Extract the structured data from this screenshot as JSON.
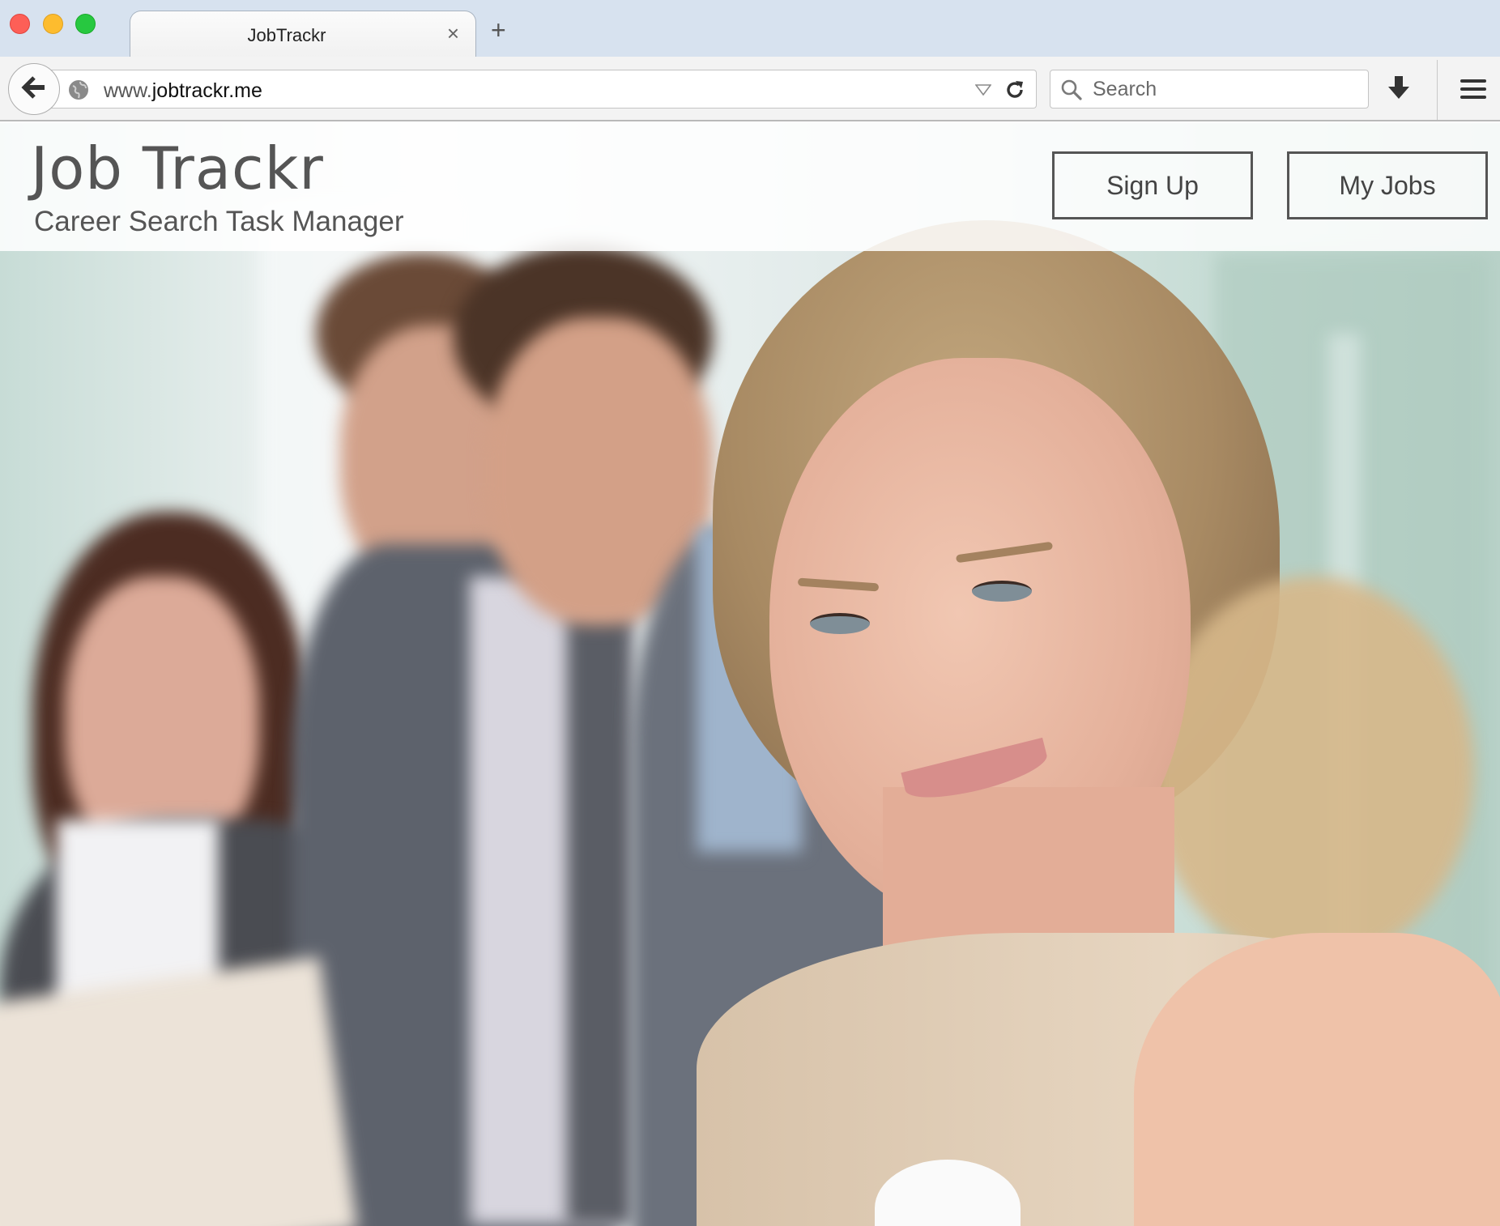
{
  "browser": {
    "tab_title": "JobTrackr",
    "url_prefix": "www.",
    "url_domain": "jobtrackr.me",
    "search_placeholder": "Search"
  },
  "site": {
    "title": "Job Trackr",
    "tagline": "Career Search Task Manager",
    "signup_label": "Sign Up",
    "myjobs_label": "My Jobs"
  }
}
